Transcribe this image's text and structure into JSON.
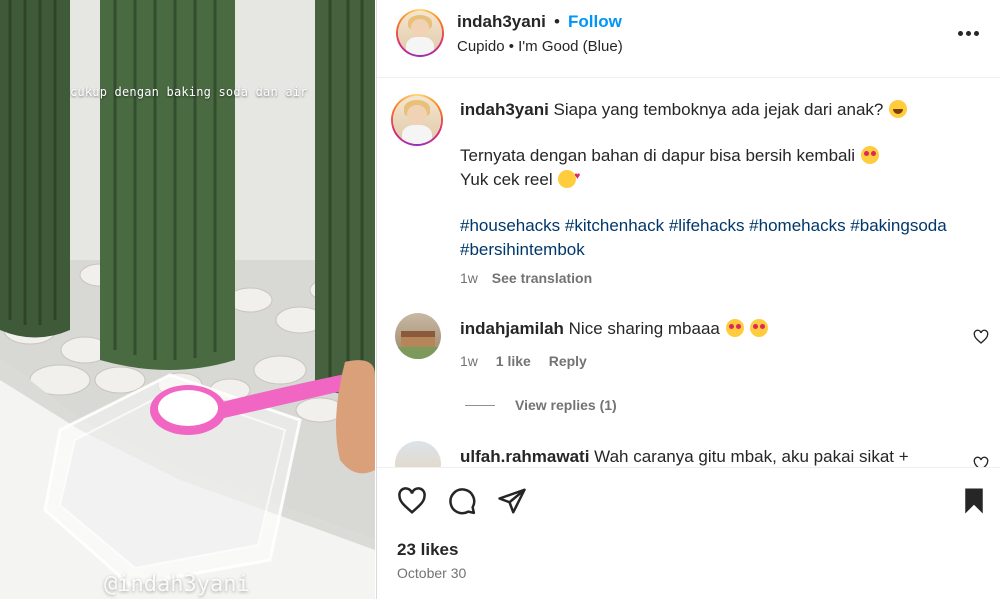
{
  "post": {
    "author": "indah3yani",
    "follow_label": "Follow",
    "separator": "•",
    "audio": "Cupido • I'm Good (Blue)",
    "overlay_text": "cukup dengan baking soda dan air",
    "watermark": "@indah3yani"
  },
  "caption": {
    "username": "indah3yani",
    "line1": "Siapa yang temboknya ada jejak dari anak?",
    "line2": "Ternyata dengan bahan di dapur bisa bersih kembali",
    "line3": "Yuk cek reel",
    "hashtags_line1": "#househacks #kitchenhack #lifehacks #homehacks #bakingsoda",
    "hashtags_line2": "#bersihintembok",
    "time": "1w",
    "see_translation": "See translation"
  },
  "comments": [
    {
      "username": "indahjamilah",
      "text": "Nice sharing mbaaa",
      "time": "1w",
      "likes": "1 like",
      "reply": "Reply",
      "view_replies": "View replies (1)"
    },
    {
      "username": "ulfah.rahmawati",
      "text": "Wah caranya gitu mbak, aku pakai sikat +"
    }
  ],
  "actions": {
    "likes": "23 likes",
    "date": "October 30"
  },
  "icons": [
    "heart-icon",
    "comment-icon",
    "share-icon",
    "bookmark-icon",
    "more-icon"
  ],
  "colors": {
    "accent": "#0095f6",
    "hashtag": "#00376b",
    "muted": "#737373"
  }
}
